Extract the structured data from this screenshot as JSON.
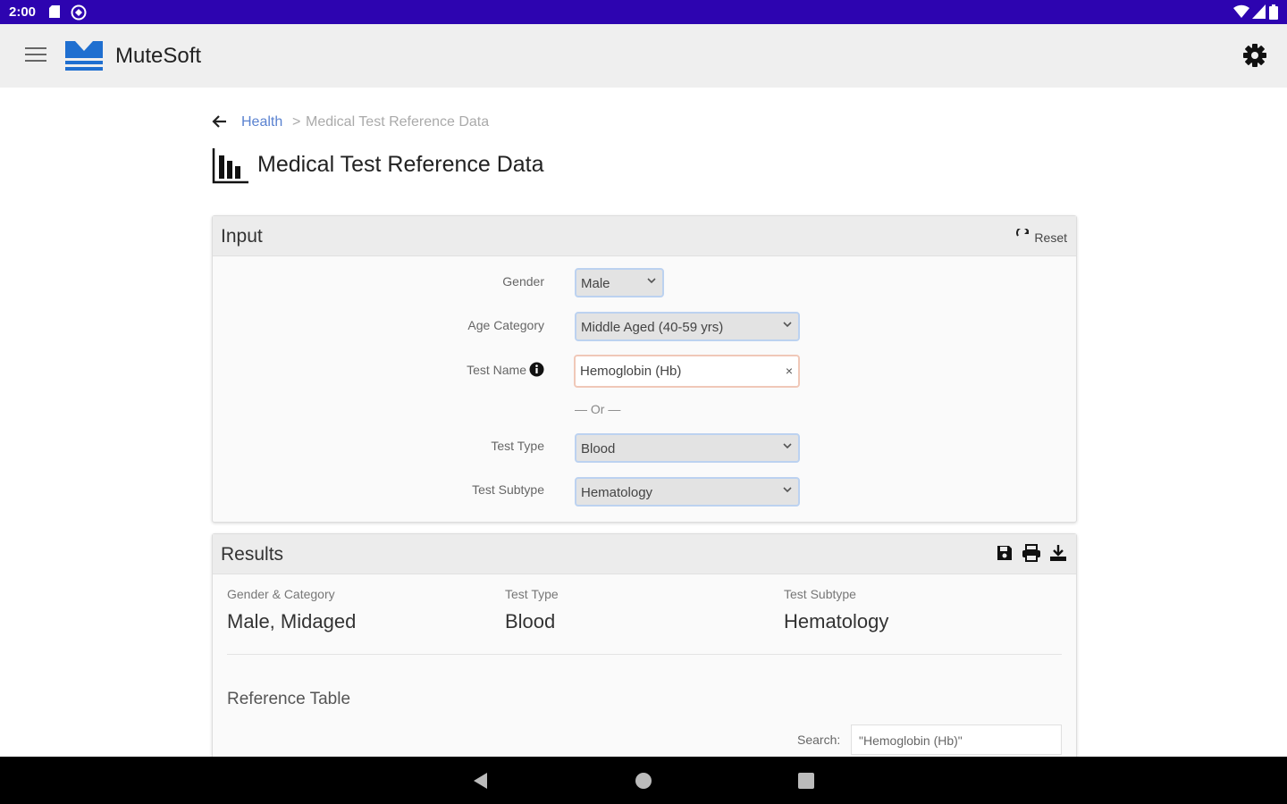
{
  "status_bar": {
    "time": "2:00"
  },
  "app": {
    "name": "MuteSoft",
    "brand_color": "#2d04b0"
  },
  "breadcrumb": {
    "parent": "Health",
    "separator": ">",
    "current": "Medical Test Reference Data"
  },
  "page": {
    "title": "Medical Test Reference Data"
  },
  "input_card": {
    "title": "Input",
    "reset_label": "Reset",
    "gender": {
      "label": "Gender",
      "value": "Male"
    },
    "age_category": {
      "label": "Age Category",
      "value": "Middle Aged (40-59 yrs)"
    },
    "test_name": {
      "label": "Test Name",
      "value": "Hemoglobin (Hb)"
    },
    "or_label": "— Or —",
    "test_type": {
      "label": "Test Type",
      "value": "Blood"
    },
    "test_subtype": {
      "label": "Test Subtype",
      "value": "Hematology"
    }
  },
  "results_card": {
    "title": "Results",
    "icons": [
      "save-icon",
      "print-icon",
      "download-icon"
    ],
    "columns": [
      {
        "header": "Gender & Category",
        "value": "Male, Midaged"
      },
      {
        "header": "Test Type",
        "value": "Blood"
      },
      {
        "header": "Test Subtype",
        "value": "Hematology"
      }
    ],
    "reference_table_title": "Reference Table",
    "search_label": "Search:",
    "search_value": "\"Hemoglobin (Hb)\""
  }
}
